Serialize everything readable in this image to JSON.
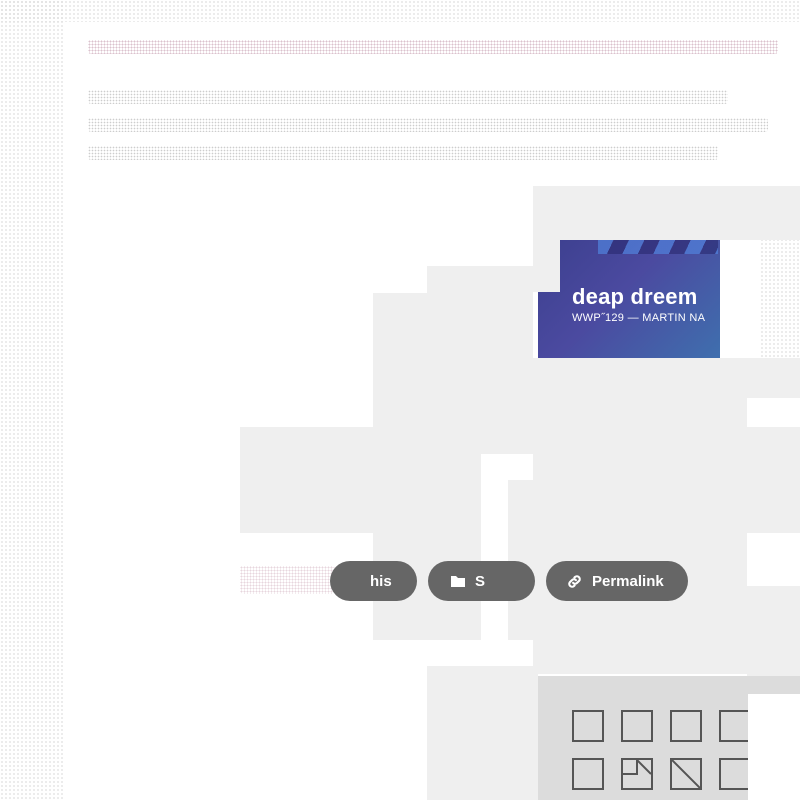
{
  "thumbnail": {
    "title": "deap dreem",
    "subtitle": "WWP˝129 — MARTIN NA"
  },
  "actions": {
    "share_label": "his",
    "category_label": "S",
    "permalink_label": "Permalink"
  },
  "icons": {
    "category": "folder-icon",
    "permalink": "link-icon"
  },
  "colors": {
    "pill_background": "#666666",
    "thumbnail_gradient_start": "#3c3f8e",
    "thumbnail_gradient_end": "#3f6fae"
  }
}
